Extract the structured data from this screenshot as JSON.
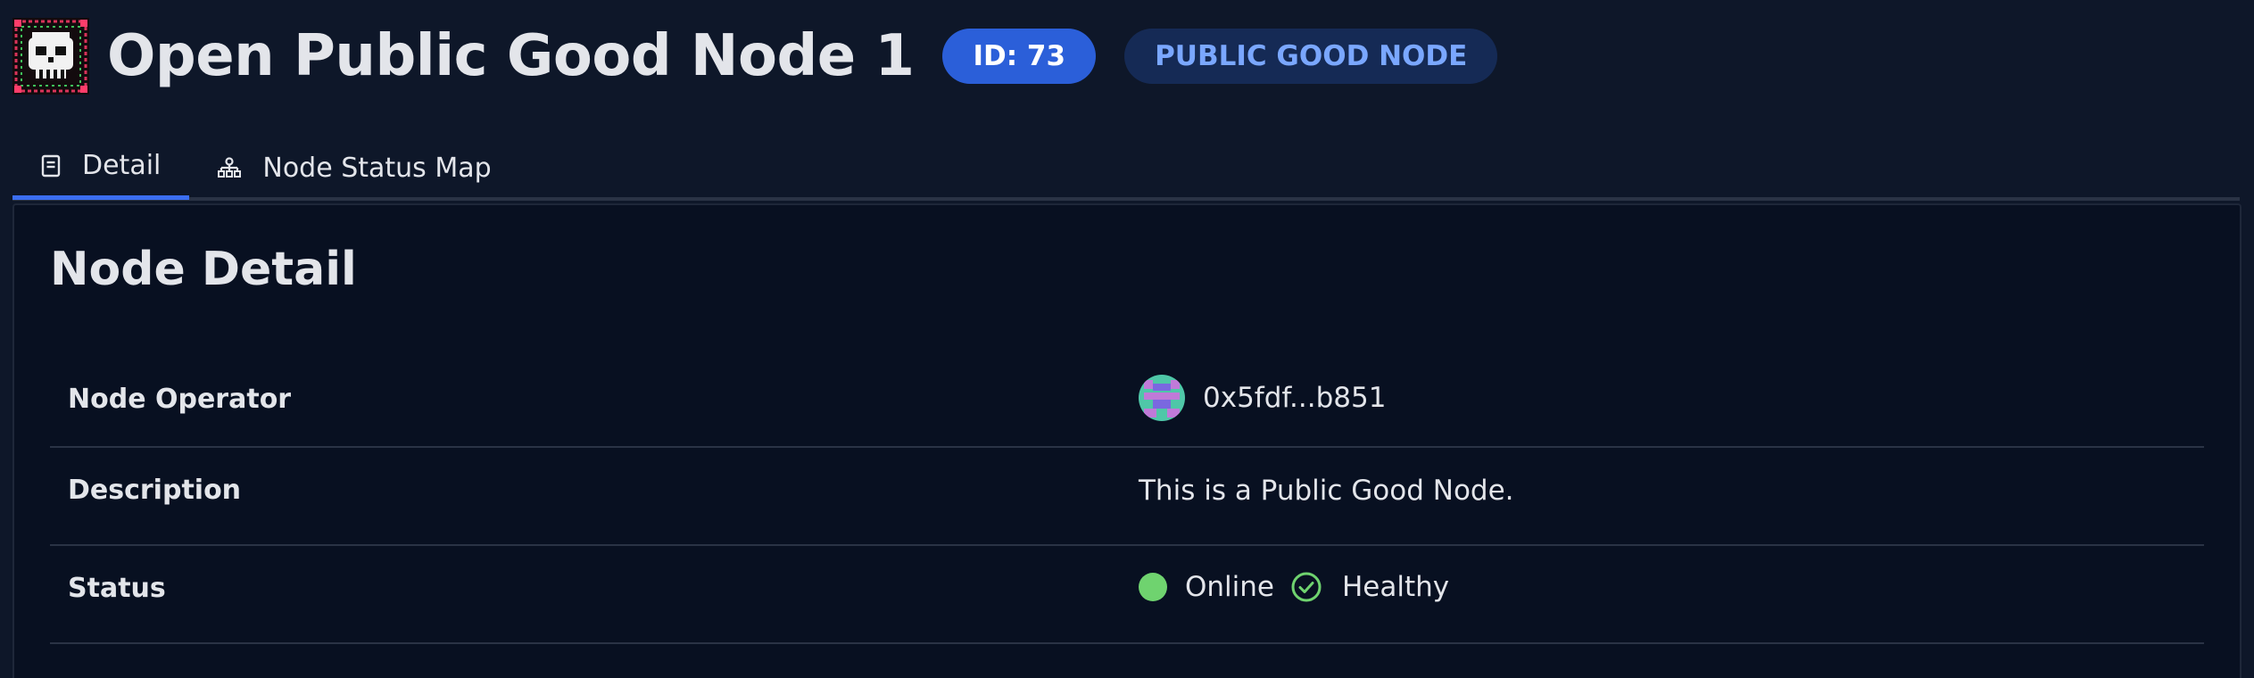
{
  "header": {
    "title": "Open Public Good Node 1",
    "id_badge": "ID: 73",
    "type_badge": "PUBLIC GOOD NODE",
    "logo_icon": "pixel-skull-logo-icon"
  },
  "tabs": [
    {
      "label": "Detail",
      "icon": "document-icon",
      "active": true
    },
    {
      "label": "Node Status Map",
      "icon": "sitemap-icon",
      "active": false
    }
  ],
  "detail": {
    "section_title": "Node Detail",
    "rows": [
      {
        "label": "Node Operator",
        "value": "0x5fdf...b851"
      },
      {
        "label": "Description",
        "value": "This is a Public Good Node."
      },
      {
        "label": "Status",
        "status": "Online",
        "health": "Healthy"
      }
    ]
  },
  "colors": {
    "background": "#0e1729",
    "panel": "#081021",
    "accent": "#2b5fd9",
    "online": "#6fd36f"
  }
}
